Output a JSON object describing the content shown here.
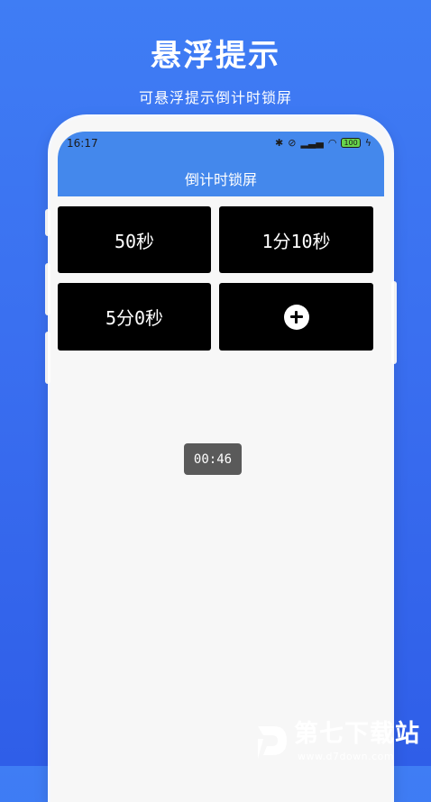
{
  "promo": {
    "title": "悬浮提示",
    "subtitle": "可悬浮提示倒计时锁屏"
  },
  "status_bar": {
    "time": "16:17",
    "battery": "100"
  },
  "app": {
    "title": "倒计时锁屏"
  },
  "presets": [
    {
      "label": "50秒"
    },
    {
      "label": "1分10秒"
    },
    {
      "label": "5分0秒"
    }
  ],
  "add_tile": {
    "icon": "plus-circle-icon"
  },
  "floating_timer": {
    "value": "00:46"
  },
  "watermark": {
    "name": "第七下载站",
    "url": "www.d7down.com"
  },
  "colors": {
    "background": "#3a6ff0",
    "header": "#4488ec",
    "tile": "#000000",
    "toast": "#5a5a5a"
  }
}
